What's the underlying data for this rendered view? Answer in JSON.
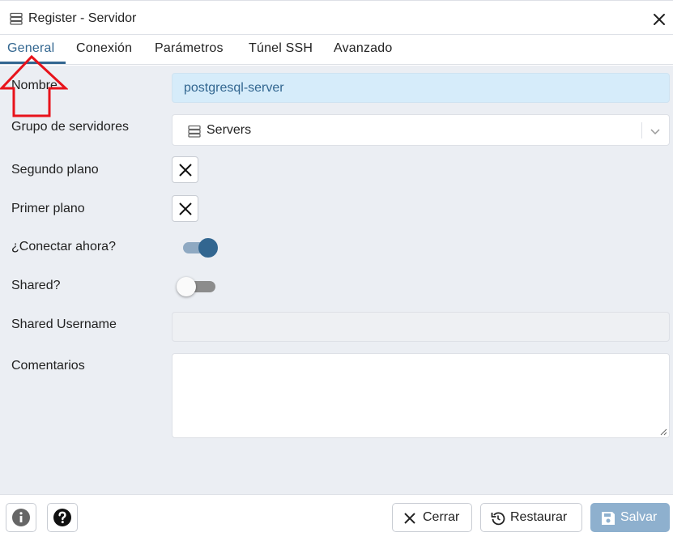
{
  "window": {
    "title": "Register - Servidor"
  },
  "tabs": [
    {
      "label": "General",
      "active": true
    },
    {
      "label": "Conexión"
    },
    {
      "label": "Parámetros"
    },
    {
      "label": "Túnel SSH"
    },
    {
      "label": "Avanzado"
    }
  ],
  "form": {
    "name": {
      "label": "Nombre",
      "value": "postgresql-server"
    },
    "server_group": {
      "label": "Grupo de servidores",
      "value": "Servers"
    },
    "background": {
      "label": "Segundo plano",
      "checked": false
    },
    "foreground": {
      "label": "Primer plano",
      "checked": false
    },
    "connect_now": {
      "label": "¿Conectar ahora?",
      "on": true
    },
    "shared": {
      "label": "Shared?",
      "on": false
    },
    "shared_username": {
      "label": "Shared Username",
      "value": ""
    },
    "comments": {
      "label": "Comentarios",
      "value": ""
    }
  },
  "footer": {
    "close_label": "Cerrar",
    "reset_label": "Restaurar",
    "save_label": "Salvar"
  },
  "colors": {
    "accent": "#326690",
    "annotation": "#e8131b",
    "field_background": "#ebeef3"
  }
}
